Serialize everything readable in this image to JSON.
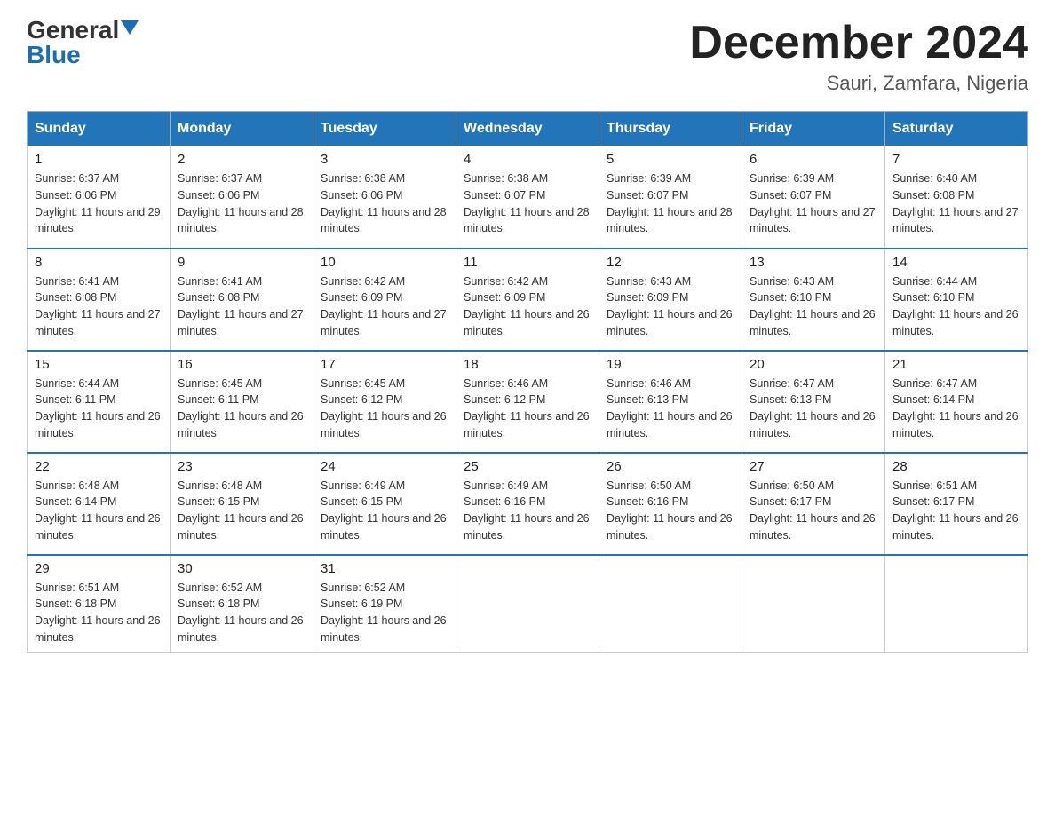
{
  "logo": {
    "general": "General",
    "blue": "Blue",
    "triangle": "▲"
  },
  "title": {
    "month_year": "December 2024",
    "location": "Sauri, Zamfara, Nigeria"
  },
  "headers": [
    "Sunday",
    "Monday",
    "Tuesday",
    "Wednesday",
    "Thursday",
    "Friday",
    "Saturday"
  ],
  "weeks": [
    [
      {
        "day": "1",
        "sunrise": "Sunrise: 6:37 AM",
        "sunset": "Sunset: 6:06 PM",
        "daylight": "Daylight: 11 hours and 29 minutes."
      },
      {
        "day": "2",
        "sunrise": "Sunrise: 6:37 AM",
        "sunset": "Sunset: 6:06 PM",
        "daylight": "Daylight: 11 hours and 28 minutes."
      },
      {
        "day": "3",
        "sunrise": "Sunrise: 6:38 AM",
        "sunset": "Sunset: 6:06 PM",
        "daylight": "Daylight: 11 hours and 28 minutes."
      },
      {
        "day": "4",
        "sunrise": "Sunrise: 6:38 AM",
        "sunset": "Sunset: 6:07 PM",
        "daylight": "Daylight: 11 hours and 28 minutes."
      },
      {
        "day": "5",
        "sunrise": "Sunrise: 6:39 AM",
        "sunset": "Sunset: 6:07 PM",
        "daylight": "Daylight: 11 hours and 28 minutes."
      },
      {
        "day": "6",
        "sunrise": "Sunrise: 6:39 AM",
        "sunset": "Sunset: 6:07 PM",
        "daylight": "Daylight: 11 hours and 27 minutes."
      },
      {
        "day": "7",
        "sunrise": "Sunrise: 6:40 AM",
        "sunset": "Sunset: 6:08 PM",
        "daylight": "Daylight: 11 hours and 27 minutes."
      }
    ],
    [
      {
        "day": "8",
        "sunrise": "Sunrise: 6:41 AM",
        "sunset": "Sunset: 6:08 PM",
        "daylight": "Daylight: 11 hours and 27 minutes."
      },
      {
        "day": "9",
        "sunrise": "Sunrise: 6:41 AM",
        "sunset": "Sunset: 6:08 PM",
        "daylight": "Daylight: 11 hours and 27 minutes."
      },
      {
        "day": "10",
        "sunrise": "Sunrise: 6:42 AM",
        "sunset": "Sunset: 6:09 PM",
        "daylight": "Daylight: 11 hours and 27 minutes."
      },
      {
        "day": "11",
        "sunrise": "Sunrise: 6:42 AM",
        "sunset": "Sunset: 6:09 PM",
        "daylight": "Daylight: 11 hours and 26 minutes."
      },
      {
        "day": "12",
        "sunrise": "Sunrise: 6:43 AM",
        "sunset": "Sunset: 6:09 PM",
        "daylight": "Daylight: 11 hours and 26 minutes."
      },
      {
        "day": "13",
        "sunrise": "Sunrise: 6:43 AM",
        "sunset": "Sunset: 6:10 PM",
        "daylight": "Daylight: 11 hours and 26 minutes."
      },
      {
        "day": "14",
        "sunrise": "Sunrise: 6:44 AM",
        "sunset": "Sunset: 6:10 PM",
        "daylight": "Daylight: 11 hours and 26 minutes."
      }
    ],
    [
      {
        "day": "15",
        "sunrise": "Sunrise: 6:44 AM",
        "sunset": "Sunset: 6:11 PM",
        "daylight": "Daylight: 11 hours and 26 minutes."
      },
      {
        "day": "16",
        "sunrise": "Sunrise: 6:45 AM",
        "sunset": "Sunset: 6:11 PM",
        "daylight": "Daylight: 11 hours and 26 minutes."
      },
      {
        "day": "17",
        "sunrise": "Sunrise: 6:45 AM",
        "sunset": "Sunset: 6:12 PM",
        "daylight": "Daylight: 11 hours and 26 minutes."
      },
      {
        "day": "18",
        "sunrise": "Sunrise: 6:46 AM",
        "sunset": "Sunset: 6:12 PM",
        "daylight": "Daylight: 11 hours and 26 minutes."
      },
      {
        "day": "19",
        "sunrise": "Sunrise: 6:46 AM",
        "sunset": "Sunset: 6:13 PM",
        "daylight": "Daylight: 11 hours and 26 minutes."
      },
      {
        "day": "20",
        "sunrise": "Sunrise: 6:47 AM",
        "sunset": "Sunset: 6:13 PM",
        "daylight": "Daylight: 11 hours and 26 minutes."
      },
      {
        "day": "21",
        "sunrise": "Sunrise: 6:47 AM",
        "sunset": "Sunset: 6:14 PM",
        "daylight": "Daylight: 11 hours and 26 minutes."
      }
    ],
    [
      {
        "day": "22",
        "sunrise": "Sunrise: 6:48 AM",
        "sunset": "Sunset: 6:14 PM",
        "daylight": "Daylight: 11 hours and 26 minutes."
      },
      {
        "day": "23",
        "sunrise": "Sunrise: 6:48 AM",
        "sunset": "Sunset: 6:15 PM",
        "daylight": "Daylight: 11 hours and 26 minutes."
      },
      {
        "day": "24",
        "sunrise": "Sunrise: 6:49 AM",
        "sunset": "Sunset: 6:15 PM",
        "daylight": "Daylight: 11 hours and 26 minutes."
      },
      {
        "day": "25",
        "sunrise": "Sunrise: 6:49 AM",
        "sunset": "Sunset: 6:16 PM",
        "daylight": "Daylight: 11 hours and 26 minutes."
      },
      {
        "day": "26",
        "sunrise": "Sunrise: 6:50 AM",
        "sunset": "Sunset: 6:16 PM",
        "daylight": "Daylight: 11 hours and 26 minutes."
      },
      {
        "day": "27",
        "sunrise": "Sunrise: 6:50 AM",
        "sunset": "Sunset: 6:17 PM",
        "daylight": "Daylight: 11 hours and 26 minutes."
      },
      {
        "day": "28",
        "sunrise": "Sunrise: 6:51 AM",
        "sunset": "Sunset: 6:17 PM",
        "daylight": "Daylight: 11 hours and 26 minutes."
      }
    ],
    [
      {
        "day": "29",
        "sunrise": "Sunrise: 6:51 AM",
        "sunset": "Sunset: 6:18 PM",
        "daylight": "Daylight: 11 hours and 26 minutes."
      },
      {
        "day": "30",
        "sunrise": "Sunrise: 6:52 AM",
        "sunset": "Sunset: 6:18 PM",
        "daylight": "Daylight: 11 hours and 26 minutes."
      },
      {
        "day": "31",
        "sunrise": "Sunrise: 6:52 AM",
        "sunset": "Sunset: 6:19 PM",
        "daylight": "Daylight: 11 hours and 26 minutes."
      },
      null,
      null,
      null,
      null
    ]
  ]
}
